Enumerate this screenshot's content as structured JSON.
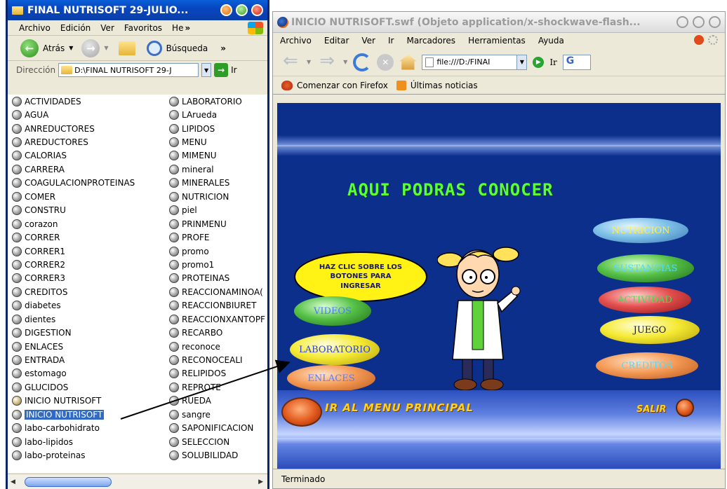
{
  "explorer": {
    "title": "FINAL NUTRISOFT 29-JULIO...",
    "menu": [
      "Archivo",
      "Edición",
      "Ver",
      "Favoritos",
      "He",
      "»"
    ],
    "toolbar": {
      "back_label": "Atrás",
      "search_label": "Búsqueda",
      "more": "»"
    },
    "address": {
      "label": "Dirección",
      "value": "D:\\FINAL NUTRISOFT 29-J",
      "go_label": "Ir"
    },
    "column1": [
      {
        "name": "ACTIVIDADES",
        "type": "swf"
      },
      {
        "name": "AGUA",
        "type": "swf"
      },
      {
        "name": "ANREDUCTORES",
        "type": "swf"
      },
      {
        "name": "AREDUCTORES",
        "type": "swf"
      },
      {
        "name": "CALORIAS",
        "type": "swf"
      },
      {
        "name": "CARRERA",
        "type": "swf"
      },
      {
        "name": "COAGULACIONPROTEINAS",
        "type": "swf"
      },
      {
        "name": "COMER",
        "type": "swf"
      },
      {
        "name": "CONSTRU",
        "type": "swf"
      },
      {
        "name": "corazon",
        "type": "swf"
      },
      {
        "name": "CORRER",
        "type": "swf"
      },
      {
        "name": "CORRER1",
        "type": "swf"
      },
      {
        "name": "CORRER2",
        "type": "swf"
      },
      {
        "name": "CORRER3",
        "type": "swf"
      },
      {
        "name": "CREDITOS",
        "type": "swf"
      },
      {
        "name": "diabetes",
        "type": "swf"
      },
      {
        "name": "dientes",
        "type": "swf"
      },
      {
        "name": "DIGESTION",
        "type": "swf"
      },
      {
        "name": "ENLACES",
        "type": "swf"
      },
      {
        "name": "ENTRADA",
        "type": "swf"
      },
      {
        "name": "estomago",
        "type": "swf"
      },
      {
        "name": "GLUCIDOS",
        "type": "swf"
      },
      {
        "name": "INICIO NUTRISOFT",
        "type": "flash"
      },
      {
        "name": "INICIO NUTRISOFT",
        "type": "swf",
        "selected": true
      },
      {
        "name": "labo-carbohidrato",
        "type": "swf"
      },
      {
        "name": "labo-lipidos",
        "type": "swf"
      },
      {
        "name": "labo-proteinas",
        "type": "swf"
      }
    ],
    "column2": [
      {
        "name": "LABORATORIO",
        "type": "swf"
      },
      {
        "name": "LArueda",
        "type": "swf"
      },
      {
        "name": "LIPIDOS",
        "type": "swf"
      },
      {
        "name": "MENU",
        "type": "swf"
      },
      {
        "name": "MIMENU",
        "type": "swf"
      },
      {
        "name": "mineral",
        "type": "swf"
      },
      {
        "name": "MINERALES",
        "type": "swf"
      },
      {
        "name": "NUTRICION",
        "type": "swf"
      },
      {
        "name": "piel",
        "type": "swf"
      },
      {
        "name": "PRINMENU",
        "type": "swf"
      },
      {
        "name": "PROFE",
        "type": "swf"
      },
      {
        "name": "promo",
        "type": "swf"
      },
      {
        "name": "promo1",
        "type": "swf"
      },
      {
        "name": "PROTEINAS",
        "type": "swf"
      },
      {
        "name": "REACCIONAMINOA(",
        "type": "swf"
      },
      {
        "name": "REACCIONBIURET",
        "type": "swf"
      },
      {
        "name": "REACCIONXANTOPF",
        "type": "swf"
      },
      {
        "name": "RECARBO",
        "type": "swf"
      },
      {
        "name": "reconoce",
        "type": "swf"
      },
      {
        "name": "RECONOCEALI",
        "type": "swf"
      },
      {
        "name": "RELIPIDOS",
        "type": "swf"
      },
      {
        "name": "REPROTE",
        "type": "swf"
      },
      {
        "name": "RUEDA",
        "type": "swf"
      },
      {
        "name": "sangre",
        "type": "swf"
      },
      {
        "name": "SAPONIFICACION",
        "type": "swf"
      },
      {
        "name": "SELECCION",
        "type": "swf"
      },
      {
        "name": "SOLUBILIDAD",
        "type": "swf"
      }
    ]
  },
  "firefox": {
    "title": "INICIO NUTRISOFT.swf (Objeto application/x-shockwave-flash...",
    "menu": [
      "Archivo",
      "Editar",
      "Ver",
      "Ir",
      "Marcadores",
      "Herramientas",
      "Ayuda"
    ],
    "url": "file:///D:/FINAI",
    "go_label": "Ir",
    "search_glyph": "G",
    "bookmarks": [
      "Comenzar con Firefox",
      "Últimas noticias"
    ],
    "status": "Terminado"
  },
  "flash": {
    "headline": "AQUI  PODRAS  CONOCER",
    "bubble": "HAZ CLIC SOBRE LOS BOTONES PARA INGRESAR",
    "left_buttons": [
      {
        "label": "VIDEOS",
        "text_color": "#4a7bff",
        "style": "green"
      },
      {
        "label": "LABORATORIO",
        "text_color": "#2c3ed6",
        "style": "yellow"
      },
      {
        "label": "ENLACES",
        "text_color": "#5a7bff",
        "style": "orange"
      }
    ],
    "right_buttons": [
      {
        "label": "NUTRICION",
        "text_color": "#ffee44",
        "style": "blue"
      },
      {
        "label": "SUSTANCIAS",
        "text_color": "#4fd9ff",
        "style": "green"
      },
      {
        "label": "ACTIVIDAD",
        "text_color": "#3ae64a",
        "style": "red"
      },
      {
        "label": "JUEGO",
        "text_color": "#1a1a1a",
        "style": "yellow"
      },
      {
        "label": "CREDITOS",
        "text_color": "#4fd9ff",
        "style": "orange"
      }
    ],
    "menu_label": "IR AL MENU PRINCIPAL",
    "exit_label": "SALIR"
  },
  "colors": {
    "flash_bg": "#0c2f8c",
    "headline": "#5bff39",
    "selection": "#316ac5"
  }
}
